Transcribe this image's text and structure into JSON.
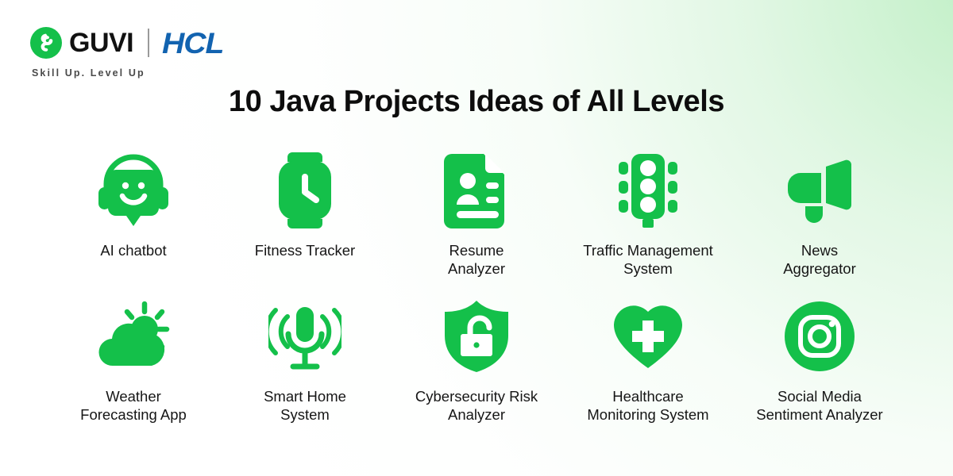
{
  "brand": {
    "logo_mark": "guvi-g-logo",
    "name": "GUVI",
    "tagline": "Skill Up. Level Up",
    "partner": "HCL",
    "green": "#14c04a",
    "partner_blue": "#1263b0"
  },
  "header": {
    "title": "10 Java Projects Ideas of All Levels"
  },
  "projects": [
    {
      "label": "AI chatbot",
      "lines": [
        "AI chatbot"
      ],
      "icon": "chatbot-headset-icon"
    },
    {
      "label": "Fitness Tracker",
      "lines": [
        "Fitness Tracker"
      ],
      "icon": "smartwatch-icon"
    },
    {
      "label": "Resume Analyzer",
      "lines": [
        "Resume",
        "Analyzer"
      ],
      "icon": "resume-document-icon"
    },
    {
      "label": "Traffic Management System",
      "lines": [
        "Traffic Management",
        "System"
      ],
      "icon": "traffic-light-icon"
    },
    {
      "label": "News Aggregator",
      "lines": [
        "News",
        "Aggregator"
      ],
      "icon": "megaphone-icon"
    },
    {
      "label": "Weather Forecasting App",
      "lines": [
        "Weather",
        "Forecasting App"
      ],
      "icon": "sun-cloud-icon"
    },
    {
      "label": "Smart Home System",
      "lines": [
        "Smart Home",
        "System"
      ],
      "icon": "microphone-voice-icon"
    },
    {
      "label": "Cybersecurity Risk Analyzer",
      "lines": [
        "Cybersecurity Risk",
        "Analyzer"
      ],
      "icon": "shield-unlock-icon"
    },
    {
      "label": "Healthcare Monitoring System",
      "lines": [
        "Healthcare",
        "Monitoring System"
      ],
      "icon": "heart-cross-icon"
    },
    {
      "label": "Social Media Sentiment Analyzer",
      "lines": [
        "Social Media",
        "Sentiment Analyzer"
      ],
      "icon": "instagram-circle-icon"
    }
  ]
}
